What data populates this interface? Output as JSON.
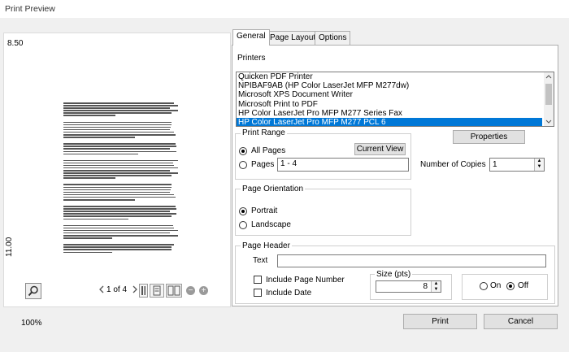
{
  "window": {
    "title": "Print Preview"
  },
  "preview": {
    "ruler_top": "8.50",
    "ruler_side": "11.00",
    "page_label_of": "of",
    "current_page": "1",
    "total_pages": "4",
    "zoom_level": "100%"
  },
  "tabs": [
    {
      "label": "General",
      "active": true
    },
    {
      "label": "Page Layout",
      "active": false
    },
    {
      "label": "Options",
      "active": false
    }
  ],
  "printers": {
    "label": "Printers",
    "items": [
      "Quicken PDF Printer",
      "NPIBAF9AB (HP Color LaserJet MFP M277dw)",
      "Microsoft XPS Document Writer",
      "Microsoft Print to PDF",
      "HP Color LaserJet Pro MFP M277 Series Fax",
      "HP Color LaserJet Pro MFP M277 PCL 6"
    ],
    "selected_index": 5,
    "properties_label": "Properties"
  },
  "print_range": {
    "title": "Print Range",
    "all_pages_label": "All Pages",
    "pages_label": "Pages",
    "pages_value": "1 - 4",
    "current_view_label": "Current View",
    "selected": "all"
  },
  "copies": {
    "label": "Number of Copies",
    "value": "1"
  },
  "orientation": {
    "title": "Page Orientation",
    "portrait_label": "Portrait",
    "landscape_label": "Landscape",
    "selected": "portrait"
  },
  "page_header": {
    "title": "Page Header",
    "text_label": "Text",
    "text_value": "",
    "include_page_number_label": "Include Page Number",
    "include_date_label": "Include Date",
    "size_label": "Size (pts)",
    "size_value": "8",
    "on_label": "On",
    "off_label": "Off",
    "state": "off"
  },
  "footer": {
    "print_label": "Print",
    "cancel_label": "Cancel"
  },
  "colors": {
    "selection": "#0078d7",
    "window_bg": "#f0f0f0"
  }
}
